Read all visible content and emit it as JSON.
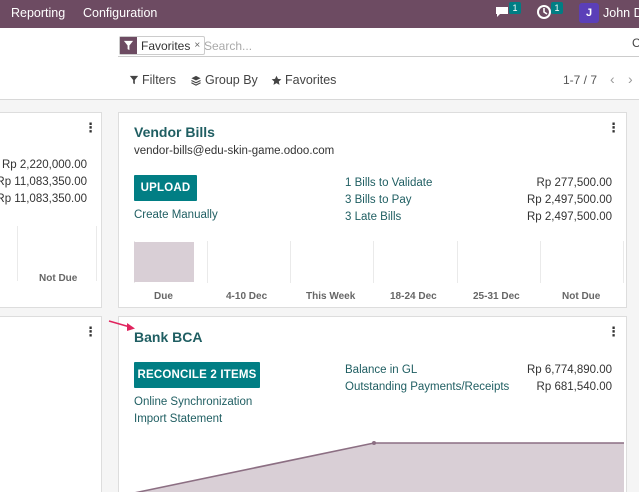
{
  "navbar": {
    "menu": [
      "Reporting",
      "Configuration"
    ],
    "messages_badge": "1",
    "activities_badge": "1",
    "user_initial": "J",
    "user_name": "John Doe"
  },
  "search": {
    "facet_label": "Favorites",
    "facet_close": "×",
    "placeholder": "Search..."
  },
  "toolbar": {
    "filters_label": "Filters",
    "groupby_label": "Group By",
    "favorites_label": "Favorites",
    "pager": "1-7 / 7"
  },
  "left_card_top": {
    "amounts": [
      "Rp 2,220,000.00",
      "Rp 11,083,350.00",
      "Rp 11,083,350.00"
    ],
    "axis_label": "Not Due"
  },
  "vendor_bills": {
    "title": "Vendor Bills",
    "email": "vendor-bills@edu-skin-game.odoo.com",
    "upload_label": "UPLOAD",
    "create_manually_label": "Create Manually",
    "stats": [
      {
        "label": "1 Bills to Validate",
        "amount": "Rp 277,500.00"
      },
      {
        "label": "3 Bills to Pay",
        "amount": "Rp 2,497,500.00"
      },
      {
        "label": "3 Late Bills",
        "amount": "Rp 2,497,500.00"
      }
    ],
    "chart_labels": [
      "Due",
      "4-10 Dec",
      "This Week",
      "18-24 Dec",
      "25-31 Dec",
      "Not Due"
    ]
  },
  "bank_bca": {
    "title": "Bank BCA",
    "reconcile_label": "RECONCILE 2 ITEMS",
    "online_sync_label": "Online Synchronization",
    "import_statement_label": "Import Statement",
    "stats": [
      {
        "label": "Balance in GL",
        "amount": "Rp 6,774,890.00"
      },
      {
        "label": "Outstanding Payments/Receipts",
        "amount": "Rp 681,540.00"
      }
    ]
  },
  "colors": {
    "navbar": "#6d4b62",
    "primary": "#017e84",
    "title": "#1f5e62",
    "chart_fill": "#d9cfd6",
    "chart_line": "#8c6f83",
    "annotation_arrow": "#e0245e"
  }
}
